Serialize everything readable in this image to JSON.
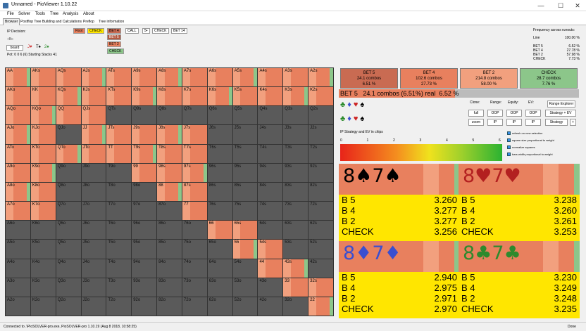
{
  "window": {
    "title": "Unnamed - PioViewer 1.10.22",
    "minimize": "—",
    "maximize": "☐",
    "close": "✕"
  },
  "menu": [
    "File",
    "Solver",
    "Tools",
    "Tree",
    "Analysis",
    "About"
  ],
  "tabs": [
    "Browser",
    "Postflop Tree Building and Calculations",
    "Preflop",
    "Tree information"
  ],
  "left_info": {
    "ip_decision": "IP Decision:",
    "board_code": "+Bc",
    "board_button": "board",
    "cards": [
      "J♥",
      "T♠",
      "2♠"
    ],
    "pot_stacks": "Pot: 0 0 6 (6) Starting Stacks 41"
  },
  "actions": {
    "col1": [
      "Root",
      "CHECK"
    ],
    "col2": [
      "BET 4",
      "BET 5",
      "BET 2",
      "CHECK"
    ],
    "col3": [
      "CALL"
    ],
    "col4": [
      "5•"
    ],
    "col5": [
      "CHECK"
    ],
    "col6": [
      "BET 14"
    ]
  },
  "frequency": {
    "title": "Frequency across runouts:",
    "rows": [
      [
        "Line",
        "100.00 %"
      ],
      [
        "",
        ""
      ],
      [
        "BET 5",
        "6.52 %"
      ],
      [
        "BET 4",
        "27.78 %"
      ],
      [
        "BET 2",
        "57.98 %"
      ],
      [
        "CHECK",
        "7.73 %"
      ]
    ]
  },
  "grid": [
    [
      "AA",
      "AKs",
      "AQs",
      "AJs",
      "ATs",
      "A9s",
      "A8s",
      "A7s",
      "A6s",
      "A5s",
      "A4s",
      "A3s",
      "A2s"
    ],
    [
      "AKo",
      "KK",
      "KQs",
      "KJs",
      "KTs",
      "K9s",
      "K8s",
      "K7s",
      "K6s",
      "K5s",
      "K4s",
      "K3s",
      "K2s"
    ],
    [
      "AQo",
      "KQo",
      "QQ",
      "QJs",
      "QTs",
      "Q9s",
      "Q8s",
      "Q7s",
      "Q6s",
      "Q5s",
      "Q4s",
      "Q3s",
      "Q2s"
    ],
    [
      "AJo",
      "KJo",
      "QJo",
      "JJ",
      "JTs",
      "J9s",
      "J8s",
      "J7s",
      "J6s",
      "J5s",
      "J4s",
      "J3s",
      "J2s"
    ],
    [
      "ATo",
      "KTo",
      "QTo",
      "JTo",
      "TT",
      "T9s",
      "T8s",
      "T7s",
      "T6s",
      "T5s",
      "T4s",
      "T3s",
      "T2s"
    ],
    [
      "A9o",
      "K9o",
      "Q9o",
      "J9o",
      "T9o",
      "99",
      "98s",
      "97s",
      "96s",
      "95s",
      "94s",
      "93s",
      "92s"
    ],
    [
      "A8o",
      "K8o",
      "Q8o",
      "J8o",
      "T8o",
      "98o",
      "88",
      "87s",
      "86s",
      "85s",
      "84s",
      "83s",
      "82s"
    ],
    [
      "A7o",
      "K7o",
      "Q7o",
      "J7o",
      "T7o",
      "97o",
      "87o",
      "77",
      "76s",
      "75s",
      "74s",
      "73s",
      "72s"
    ],
    [
      "A6o",
      "K6o",
      "Q6o",
      "J6o",
      "T6o",
      "96o",
      "86o",
      "76o",
      "66",
      "65s",
      "64s",
      "63s",
      "62s"
    ],
    [
      "A5o",
      "K5o",
      "Q5o",
      "J5o",
      "T5o",
      "95o",
      "85o",
      "75o",
      "65o",
      "55",
      "54s",
      "53s",
      "52s"
    ],
    [
      "A4o",
      "K4o",
      "Q4o",
      "J4o",
      "T4o",
      "94o",
      "84o",
      "74o",
      "64o",
      "54o",
      "44",
      "43s",
      "42s"
    ],
    [
      "A3o",
      "K3o",
      "Q3o",
      "J3o",
      "T3o",
      "93o",
      "83o",
      "73o",
      "63o",
      "53o",
      "43o",
      "33",
      "32s"
    ],
    [
      "A2o",
      "K2o",
      "Q2o",
      "J2o",
      "T2o",
      "92o",
      "82o",
      "72o",
      "62o",
      "52o",
      "42o",
      "32o",
      "22"
    ]
  ],
  "bubbles": [
    {
      "name": "BET 5",
      "combos": "24.1 combos",
      "pct": "6.51 %",
      "color": "#c96b52"
    },
    {
      "name": "BET 4",
      "combos": "102.6 combos",
      "pct": "27.73 %",
      "color": "#e8805e"
    },
    {
      "name": "BET 2",
      "combos": "214.8 combos",
      "pct": "58.00 %",
      "color": "#f2a07e"
    },
    {
      "name": "CHECK",
      "combos": "28.7 combos",
      "pct": "7.76 %",
      "color": "#8cc68a"
    }
  ],
  "selection_bar": "BET 5   24.1 combos (6.51%) real  6.52 %",
  "suits_row1": [
    "♣",
    "♦",
    "♥",
    "♠"
  ],
  "suits_row2": [
    "♣",
    "♦",
    "♥",
    "♠"
  ],
  "controls": {
    "headers": [
      "Clone:",
      "Range:",
      "Equity:",
      "EV:"
    ],
    "row1": [
      "full",
      "OOP",
      "OOP",
      "OOP",
      "Strategy + EV"
    ],
    "row2": [
      "zoom",
      "IP",
      "IP",
      "IP",
      "Strategy",
      "+"
    ],
    "range_explorer": "Range Explorer"
  },
  "checks": [
    "refresh on new selection",
    "square size proportional to weight",
    "normalize squares",
    "bars width proportional to weight"
  ],
  "ev_label": "IP Strategy and EV in chips",
  "scale": [
    "0",
    "1",
    "2",
    "3",
    "4",
    "5",
    "6"
  ],
  "cards": [
    {
      "combo": "8♠7♠",
      "color": "#000",
      "rows": [
        [
          "B 5",
          "3.260"
        ],
        [
          "B 4",
          "3.277"
        ],
        [
          "B 2",
          "3.277"
        ],
        [
          "CHECK",
          "3.256"
        ]
      ]
    },
    {
      "combo": "8♥7♥",
      "color": "#b32020",
      "rows": [
        [
          "B 5",
          "3.238"
        ],
        [
          "B 4",
          "3.260"
        ],
        [
          "B 2",
          "3.261"
        ],
        [
          "CHECK",
          "3.253"
        ]
      ]
    },
    {
      "combo": "8♦7♦",
      "color": "#3a4fd0",
      "rows": [
        [
          "B 5",
          "2.940"
        ],
        [
          "B 4",
          "2.975"
        ],
        [
          "B 2",
          "2.971"
        ],
        [
          "CHECK",
          "2.970"
        ]
      ]
    },
    {
      "combo": "8♣7♣",
      "color": "#2d8a2d",
      "rows": [
        [
          "B 5",
          "3.230"
        ],
        [
          "B 4",
          "3.249"
        ],
        [
          "B 2",
          "3.248"
        ],
        [
          "CHECK",
          "3.235"
        ]
      ]
    }
  ],
  "status": {
    "left": "Connected to .\\PioSOLVER-pro.exe, PioSOLVER-pro 1.10.19 (Aug 8 2018, 10:58:25)",
    "right": "Done"
  },
  "colors": {
    "dark_cell": "#5a5a5a",
    "bet_color": "#e8805e",
    "check_color": "#8cc68a"
  }
}
